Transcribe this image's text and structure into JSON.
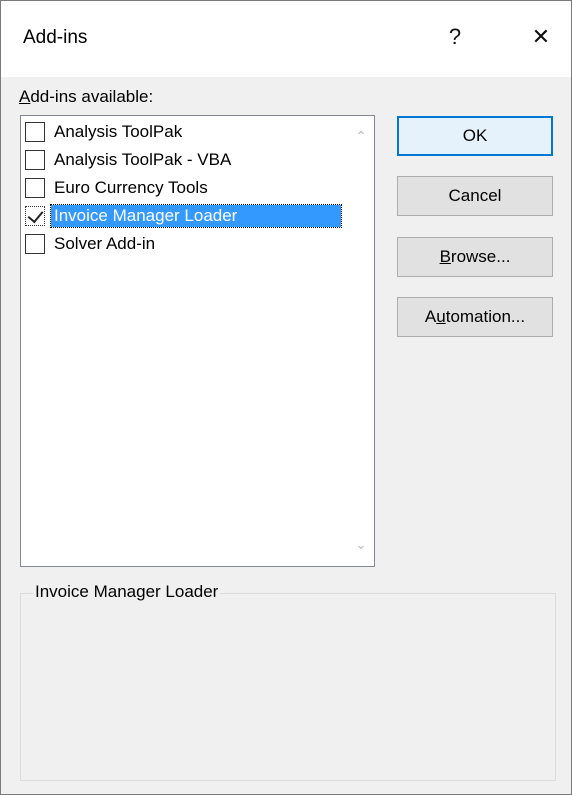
{
  "title": "Add-ins",
  "title_buttons": {
    "help": "?",
    "close": "✕"
  },
  "avail_label": {
    "underlined": "A",
    "rest": "dd-ins available:"
  },
  "addins": [
    {
      "label": "Analysis ToolPak",
      "checked": false,
      "selected": false
    },
    {
      "label": "Analysis ToolPak - VBA",
      "checked": false,
      "selected": false
    },
    {
      "label": "Euro Currency Tools",
      "checked": false,
      "selected": false
    },
    {
      "label": "Invoice Manager Loader",
      "checked": true,
      "selected": true
    },
    {
      "label": "Solver Add-in",
      "checked": false,
      "selected": false
    }
  ],
  "buttons": {
    "ok": "OK",
    "cancel": "Cancel",
    "browse": {
      "underlined": "B",
      "rest": "rowse..."
    },
    "automation": {
      "pre": "A",
      "underlined": "u",
      "rest": "tomation..."
    }
  },
  "description_group": {
    "title": "Invoice Manager Loader"
  },
  "colors": {
    "selection": "#3399ff",
    "default_button_border": "#0078d7"
  }
}
